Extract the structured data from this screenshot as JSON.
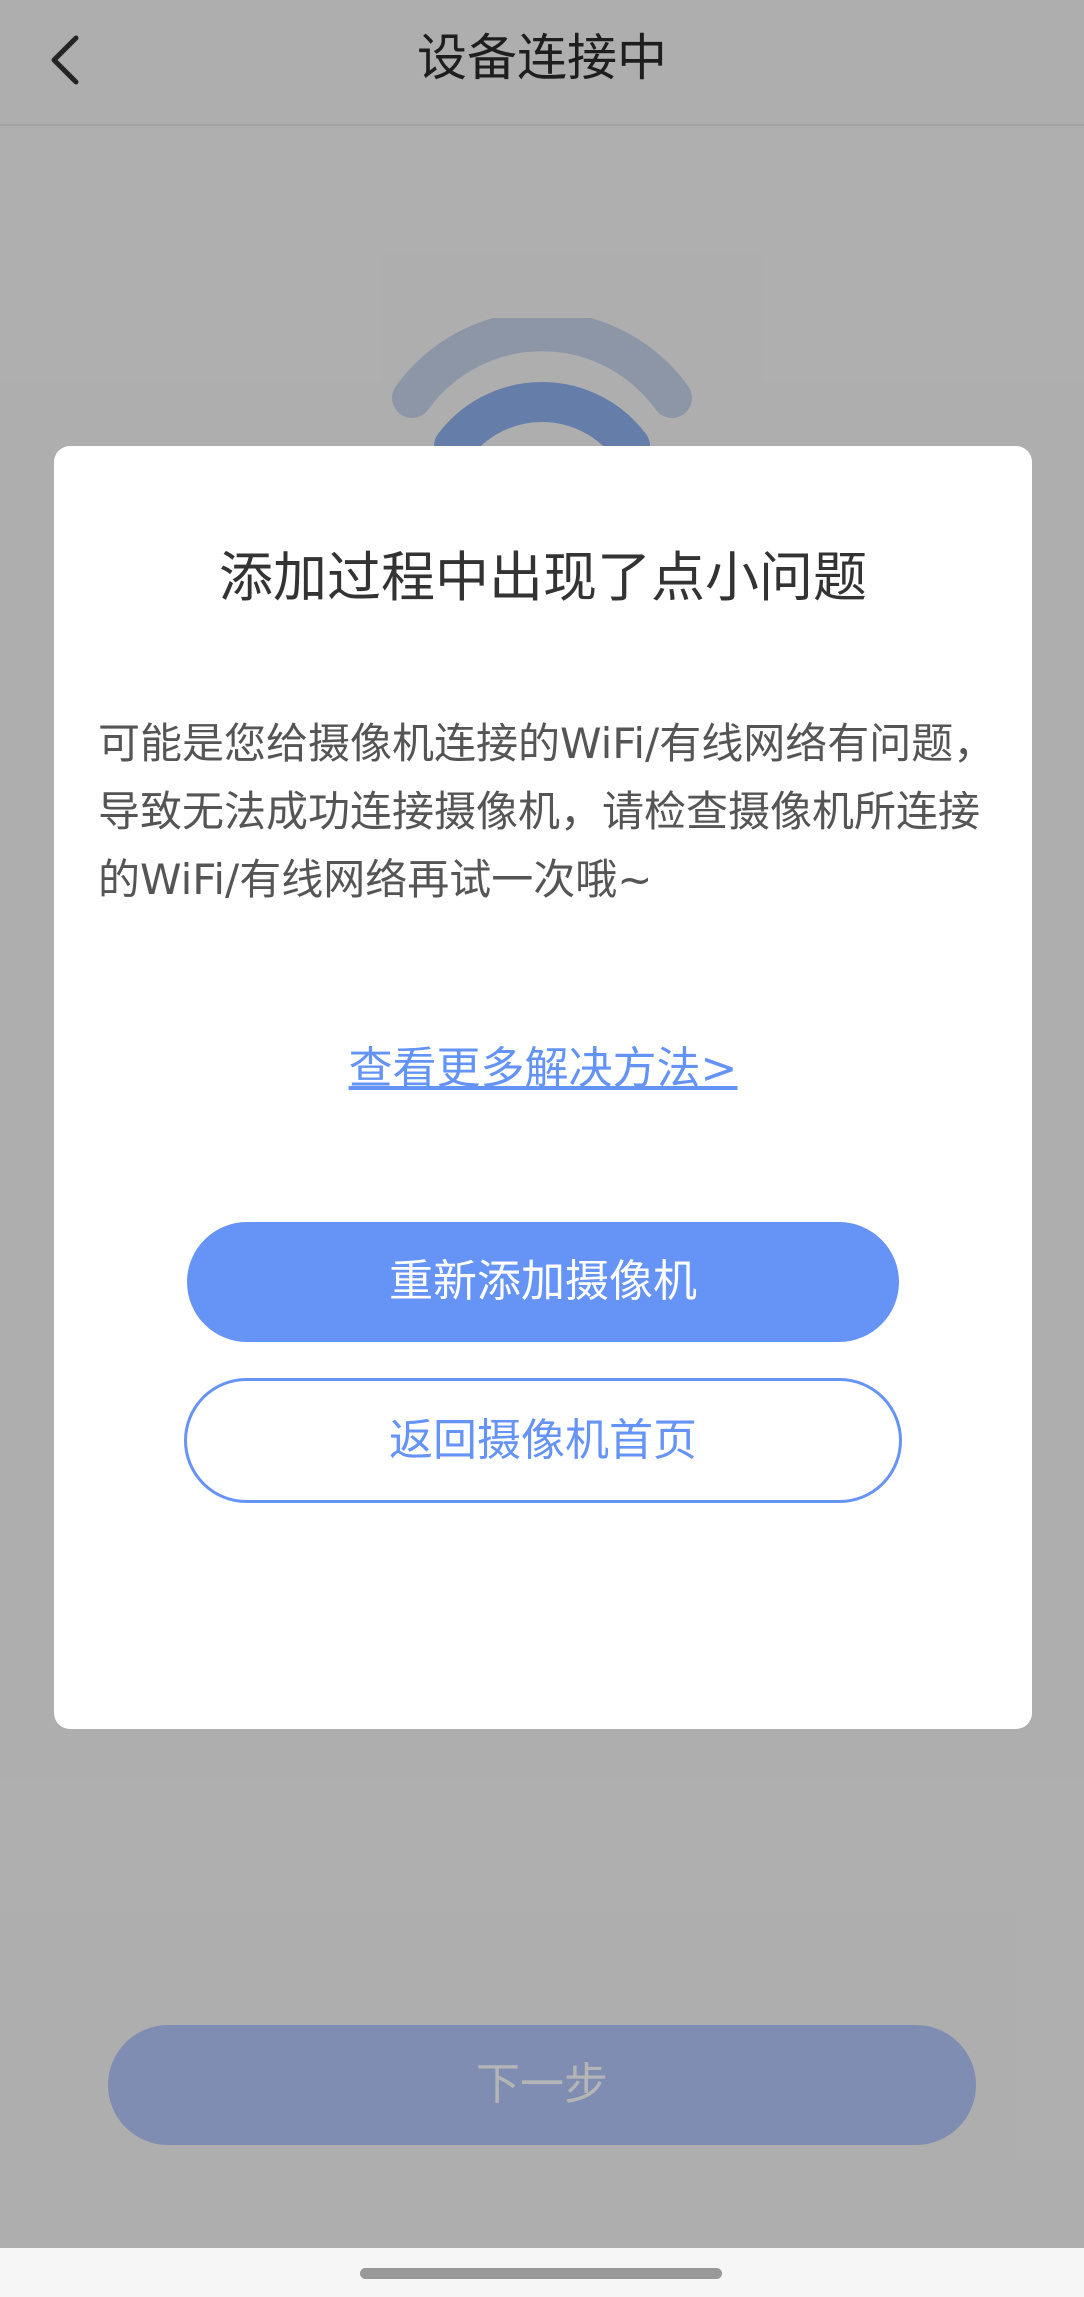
{
  "nav": {
    "title": "设备连接中",
    "back_icon": "chevron-left-icon"
  },
  "background": {
    "wifi_icon": "wifi-icon",
    "next_label": "下一步"
  },
  "dialog": {
    "title": "添加过程中出现了点小问题",
    "message": "可能是您给摄像机连接的WiFi/有线网络有问题，导致无法成功连接摄像机，请检查摄像机所连接的WiFi/有线网络再试一次哦~",
    "more_link": "查看更多解决方法>",
    "readd_label": "重新添加摄像机",
    "home_label": "返回摄像机首页"
  },
  "colors": {
    "accent": "#6693f6",
    "overlay": "rgba(0,0,0,0.29)"
  }
}
